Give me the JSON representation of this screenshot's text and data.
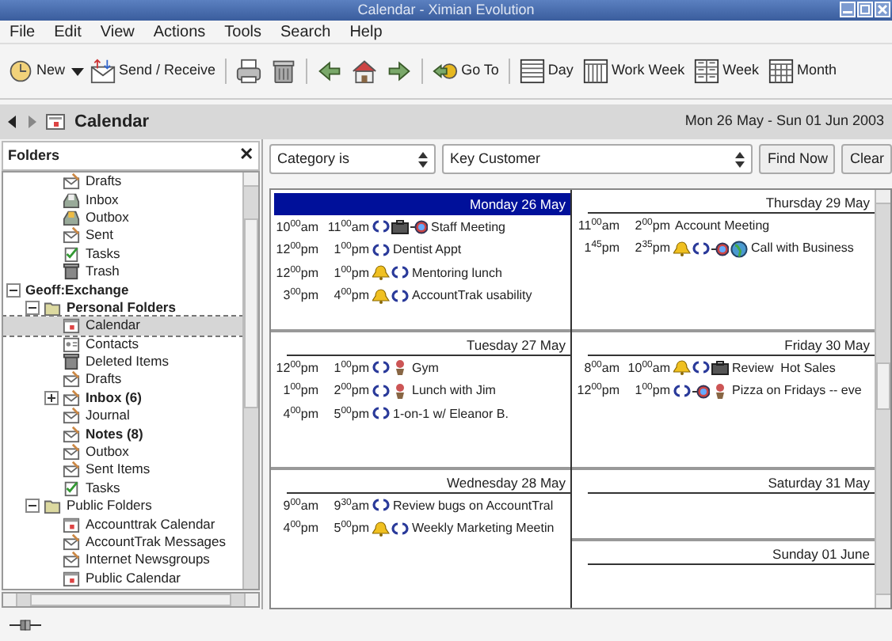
{
  "window": {
    "title": "Calendar - Ximian Evolution"
  },
  "menu": [
    "File",
    "Edit",
    "View",
    "Actions",
    "Tools",
    "Search",
    "Help"
  ],
  "toolbar": [
    {
      "kind": "new",
      "label": "New",
      "dropdown": true
    },
    {
      "kind": "send",
      "label": "Send / Receive"
    },
    {
      "kind": "print"
    },
    {
      "kind": "delete"
    },
    {
      "kind": "back"
    },
    {
      "kind": "home"
    },
    {
      "kind": "forward"
    },
    {
      "kind": "goto",
      "label": "Go To"
    },
    {
      "kind": "day",
      "label": "Day"
    },
    {
      "kind": "workweek",
      "label": "Work Week"
    },
    {
      "kind": "week",
      "label": "Week"
    },
    {
      "kind": "month",
      "label": "Month"
    }
  ],
  "header": {
    "title": "Calendar",
    "range": "Mon 26 May - Sun 01 Jun 2003"
  },
  "folders": {
    "title": "Folders",
    "close": "✕",
    "items": [
      {
        "label": "Drafts",
        "kind": "draft",
        "bold": false,
        "selected": false
      },
      {
        "label": "Inbox",
        "kind": "inbox",
        "bold": false,
        "selected": false
      },
      {
        "label": "Outbox",
        "kind": "outbox",
        "bold": false,
        "selected": false
      },
      {
        "label": "Sent",
        "kind": "draft",
        "bold": false,
        "selected": false
      },
      {
        "label": "Tasks",
        "kind": "tasks",
        "bold": false,
        "selected": false
      },
      {
        "label": "Trash",
        "kind": "trash",
        "bold": false,
        "selected": false
      }
    ],
    "tree": [
      {
        "label": "Geoff:Exchange",
        "bold": true,
        "selected": false,
        "expanded": true,
        "children": [
          {
            "label": "Personal Folders",
            "kind": "folder",
            "bold": true,
            "selected": false,
            "expanded": true,
            "children": [
              {
                "label": "Calendar",
                "kind": "calendar",
                "bold": false,
                "selected": true
              },
              {
                "label": "Contacts",
                "kind": "contacts",
                "bold": false,
                "selected": false
              },
              {
                "label": "Deleted Items",
                "kind": "trash",
                "bold": false,
                "selected": false
              },
              {
                "label": "Drafts",
                "kind": "draft",
                "bold": false,
                "selected": false
              },
              {
                "label": "Inbox (6)",
                "kind": "draft",
                "bold": true,
                "selected": false,
                "expanded": false
              },
              {
                "label": "Journal",
                "kind": "draft",
                "bold": false,
                "selected": false
              },
              {
                "label": "Notes (8)",
                "kind": "draft",
                "bold": true,
                "selected": false
              },
              {
                "label": "Outbox",
                "kind": "draft",
                "bold": false,
                "selected": false
              },
              {
                "label": "Sent Items",
                "kind": "draft",
                "bold": false,
                "selected": false
              },
              {
                "label": "Tasks",
                "kind": "tasks",
                "bold": false,
                "selected": false
              }
            ]
          },
          {
            "label": "Public Folders",
            "kind": "folder",
            "bold": false,
            "selected": false,
            "expanded": true,
            "children": [
              {
                "label": "Accounttrak Calendar",
                "kind": "calendar",
                "bold": false,
                "selected": false
              },
              {
                "label": "AccountTrak Messages",
                "kind": "draft",
                "bold": false,
                "selected": false
              },
              {
                "label": "Internet Newsgroups",
                "kind": "draft",
                "bold": false,
                "selected": false
              },
              {
                "label": "Public Calendar",
                "kind": "calendar",
                "bold": false,
                "selected": false
              }
            ]
          }
        ]
      }
    ]
  },
  "search": {
    "condition": "Category is",
    "value": "Key Customer",
    "buttons": [
      "Find Now",
      "Clear"
    ]
  },
  "days": [
    {
      "title": "Monday 26 May",
      "selected": true,
      "events": [
        {
          "start": "10$^{00}$am",
          "end": "11$^{00}$am",
          "alarm": false,
          "recurring": true,
          "business": true,
          "meeting": true,
          "web": false,
          "personal": false,
          "summary": "Staff Meeting"
        },
        {
          "start": "12$^{00}$pm",
          "end": "1$^{00}$pm",
          "alarm": false,
          "recurring": true,
          "business": false,
          "meeting": false,
          "web": false,
          "personal": false,
          "summary": "Dentist Appt"
        },
        {
          "start": "12$^{00}$pm",
          "end": "1$^{00}$pm",
          "alarm": true,
          "recurring": true,
          "business": false,
          "meeting": false,
          "web": false,
          "personal": false,
          "summary": "Mentoring lunch"
        },
        {
          "start": "3$^{00}$pm",
          "end": "4$^{00}$pm",
          "alarm": true,
          "recurring": true,
          "business": false,
          "meeting": false,
          "web": false,
          "personal": false,
          "summary": "AccountTrak usability"
        }
      ]
    },
    {
      "title": "Tuesday 27 May",
      "selected": false,
      "events": [
        {
          "start": "12$^{00}$pm",
          "end": "1$^{00}$pm",
          "alarm": false,
          "recurring": true,
          "business": false,
          "meeting": false,
          "web": false,
          "personal": true,
          "summary": "Gym"
        },
        {
          "start": "1$^{00}$pm",
          "end": "2$^{00}$pm",
          "alarm": false,
          "recurring": true,
          "business": false,
          "meeting": false,
          "web": false,
          "personal": true,
          "summary": "Lunch with Jim"
        },
        {
          "start": "4$^{00}$pm",
          "end": "5$^{00}$pm",
          "alarm": false,
          "recurring": true,
          "business": false,
          "meeting": false,
          "web": false,
          "personal": false,
          "summary": "1-on-1 w/ Eleanor B."
        }
      ]
    },
    {
      "title": "Wednesday 28 May",
      "selected": false,
      "events": [
        {
          "start": "9$^{00}$am",
          "end": "9$^{30}$am",
          "alarm": false,
          "recurring": true,
          "business": false,
          "meeting": false,
          "web": false,
          "personal": false,
          "summary": "Review bugs on AccountTral"
        },
        {
          "start": "4$^{00}$pm",
          "end": "5$^{00}$pm",
          "alarm": true,
          "recurring": true,
          "business": false,
          "meeting": false,
          "web": false,
          "personal": false,
          "summary": "Weekly Marketing Meetin"
        }
      ]
    },
    {
      "title": "Thursday 29 May",
      "selected": false,
      "events": [
        {
          "start": "11$^{00}$am",
          "end": "2$^{00}$pm",
          "alarm": false,
          "recurring": false,
          "business": false,
          "meeting": false,
          "web": false,
          "personal": false,
          "summary": "Account Meeting"
        },
        {
          "start": "1$^{45}$pm",
          "end": "2$^{35}$pm",
          "alarm": true,
          "recurring": true,
          "business": false,
          "meeting": true,
          "web": true,
          "personal": false,
          "summary": "Call with Business"
        }
      ]
    },
    {
      "title": "Friday 30 May",
      "selected": false,
      "events": [
        {
          "start": "8$^{00}$am",
          "end": "10$^{00}$am",
          "alarm": true,
          "recurring": true,
          "business": true,
          "meeting": false,
          "web": false,
          "personal": false,
          "summary": "Review  Hot Sales"
        },
        {
          "start": "12$^{00}$pm",
          "end": "1$^{00}$pm",
          "alarm": false,
          "recurring": true,
          "business": false,
          "meeting": true,
          "web": false,
          "personal": true,
          "summary": "Pizza on Fridays -- eve"
        }
      ]
    },
    {
      "title": "Saturday 31 May",
      "selected": false
    },
    {
      "title": "Sunday 01 June",
      "selected": false
    }
  ]
}
